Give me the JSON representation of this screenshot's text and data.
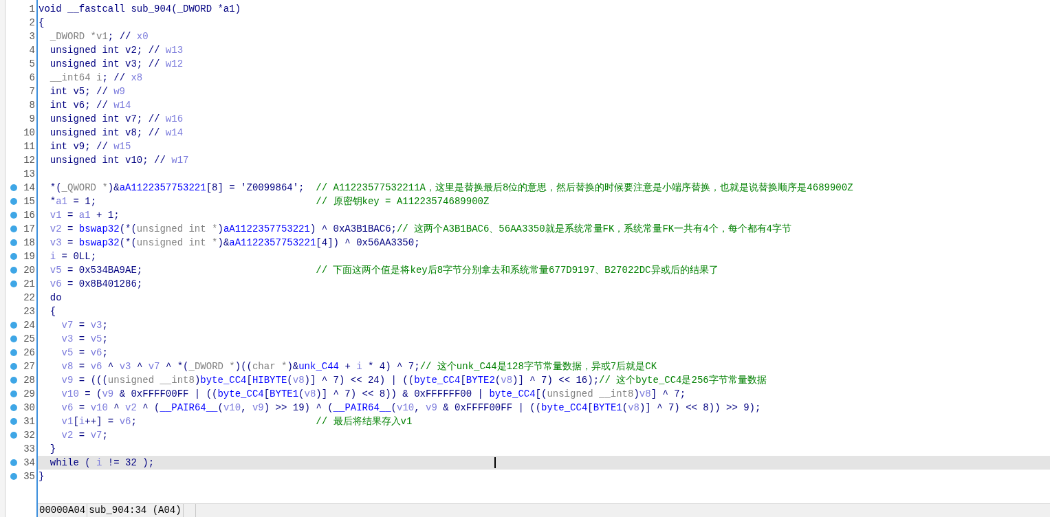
{
  "lines": [
    {
      "number": "1",
      "breakpoint": false,
      "current": false,
      "segments": [
        {
          "kind": "plain",
          "text": "void __fastcall sub_904(_DWORD *a1)"
        }
      ]
    },
    {
      "number": "2",
      "breakpoint": false,
      "current": false,
      "segments": [
        {
          "kind": "plain",
          "text": "{"
        }
      ]
    },
    {
      "number": "3",
      "breakpoint": false,
      "current": false,
      "segments": [
        {
          "kind": "type",
          "text": "  _DWORD *v1"
        },
        {
          "kind": "plain",
          "text": "; // "
        },
        {
          "kind": "local",
          "text": "x0"
        }
      ]
    },
    {
      "number": "4",
      "breakpoint": false,
      "current": false,
      "segments": [
        {
          "kind": "plain",
          "text": "  unsigned int v2; // "
        },
        {
          "kind": "local",
          "text": "w13"
        }
      ]
    },
    {
      "number": "5",
      "breakpoint": false,
      "current": false,
      "segments": [
        {
          "kind": "plain",
          "text": "  unsigned int v3; // "
        },
        {
          "kind": "local",
          "text": "w12"
        }
      ]
    },
    {
      "number": "6",
      "breakpoint": false,
      "current": false,
      "segments": [
        {
          "kind": "type",
          "text": "  __int64 i"
        },
        {
          "kind": "plain",
          "text": "; // "
        },
        {
          "kind": "local",
          "text": "x8"
        }
      ]
    },
    {
      "number": "7",
      "breakpoint": false,
      "current": false,
      "segments": [
        {
          "kind": "plain",
          "text": "  int v5; // "
        },
        {
          "kind": "local",
          "text": "w9"
        }
      ]
    },
    {
      "number": "8",
      "breakpoint": false,
      "current": false,
      "segments": [
        {
          "kind": "plain",
          "text": "  int v6; // "
        },
        {
          "kind": "local",
          "text": "w14"
        }
      ]
    },
    {
      "number": "9",
      "breakpoint": false,
      "current": false,
      "segments": [
        {
          "kind": "plain",
          "text": "  unsigned int v7; // "
        },
        {
          "kind": "local",
          "text": "w16"
        }
      ]
    },
    {
      "number": "10",
      "breakpoint": false,
      "current": false,
      "segments": [
        {
          "kind": "plain",
          "text": "  unsigned int v8; // "
        },
        {
          "kind": "local",
          "text": "w14"
        }
      ]
    },
    {
      "number": "11",
      "breakpoint": false,
      "current": false,
      "segments": [
        {
          "kind": "plain",
          "text": "  int v9; // "
        },
        {
          "kind": "local",
          "text": "w15"
        }
      ]
    },
    {
      "number": "12",
      "breakpoint": false,
      "current": false,
      "segments": [
        {
          "kind": "plain",
          "text": "  unsigned int v10; // "
        },
        {
          "kind": "local",
          "text": "w17"
        }
      ]
    },
    {
      "number": "13",
      "breakpoint": false,
      "current": false
    },
    {
      "number": "14",
      "breakpoint": true,
      "current": false,
      "segments": [
        {
          "kind": "plain",
          "text": "  *("
        },
        {
          "kind": "type",
          "text": "_QWORD *"
        },
        {
          "kind": "plain",
          "text": ")&"
        },
        {
          "kind": "global",
          "text": "aA1122357753221"
        },
        {
          "kind": "plain",
          "text": "[8] = 'Z0099864';  "
        },
        {
          "kind": "comment",
          "text": "// A11223577532211A，这里是替换最后8位的意思，然后替换的时候要注意是小端序替换，也就是说替换顺序是4689900Z"
        }
      ]
    },
    {
      "number": "15",
      "breakpoint": true,
      "current": false,
      "segments": [
        {
          "kind": "plain",
          "text": "  *"
        },
        {
          "kind": "local",
          "text": "a1"
        },
        {
          "kind": "plain",
          "text": " = 1;                                      "
        },
        {
          "kind": "comment",
          "text": "// 原密钥key = A11223574689900Z"
        }
      ]
    },
    {
      "number": "16",
      "breakpoint": true,
      "current": false,
      "segments": [
        {
          "kind": "local",
          "text": "  v1"
        },
        {
          "kind": "plain",
          "text": " = "
        },
        {
          "kind": "local",
          "text": "a1"
        },
        {
          "kind": "plain",
          "text": " + 1;"
        }
      ]
    },
    {
      "number": "17",
      "breakpoint": true,
      "current": false,
      "segments": [
        {
          "kind": "local",
          "text": "  v2"
        },
        {
          "kind": "plain",
          "text": " = "
        },
        {
          "kind": "global",
          "text": "bswap32"
        },
        {
          "kind": "plain",
          "text": "(*("
        },
        {
          "kind": "type",
          "text": "unsigned int *"
        },
        {
          "kind": "plain",
          "text": ")"
        },
        {
          "kind": "global",
          "text": "aA1122357753221"
        },
        {
          "kind": "plain",
          "text": ") ^ 0xA3B1BAC6;"
        },
        {
          "kind": "comment",
          "text": "// 这两个A3B1BAC6、56AA3350就是系统常量FK，系统常量FK一共有4个，每个都有4字节"
        }
      ]
    },
    {
      "number": "18",
      "breakpoint": true,
      "current": false,
      "segments": [
        {
          "kind": "local",
          "text": "  v3"
        },
        {
          "kind": "plain",
          "text": " = "
        },
        {
          "kind": "global",
          "text": "bswap32"
        },
        {
          "kind": "plain",
          "text": "(*("
        },
        {
          "kind": "type",
          "text": "unsigned int *"
        },
        {
          "kind": "plain",
          "text": ")&"
        },
        {
          "kind": "global",
          "text": "aA1122357753221"
        },
        {
          "kind": "plain",
          "text": "[4]) ^ 0x56AA3350;"
        }
      ]
    },
    {
      "number": "19",
      "breakpoint": true,
      "current": false,
      "segments": [
        {
          "kind": "local",
          "text": "  i"
        },
        {
          "kind": "plain",
          "text": " = 0LL;"
        }
      ]
    },
    {
      "number": "20",
      "breakpoint": true,
      "current": false,
      "segments": [
        {
          "kind": "local",
          "text": "  v5"
        },
        {
          "kind": "plain",
          "text": " = 0x534BA9AE;                              "
        },
        {
          "kind": "comment",
          "text": "// 下面这两个值是将key后8字节分别拿去和系统常量677D9197、B27022DC异或后的结果了"
        }
      ]
    },
    {
      "number": "21",
      "breakpoint": true,
      "current": false,
      "segments": [
        {
          "kind": "local",
          "text": "  v6"
        },
        {
          "kind": "plain",
          "text": " = 0x8B401286;"
        }
      ]
    },
    {
      "number": "22",
      "breakpoint": false,
      "current": false,
      "segments": [
        {
          "kind": "plain",
          "text": "  do"
        }
      ]
    },
    {
      "number": "23",
      "breakpoint": false,
      "current": false,
      "segments": [
        {
          "kind": "plain",
          "text": "  {"
        }
      ]
    },
    {
      "number": "24",
      "breakpoint": true,
      "current": false,
      "segments": [
        {
          "kind": "local",
          "text": "    v7"
        },
        {
          "kind": "plain",
          "text": " = "
        },
        {
          "kind": "local",
          "text": "v3"
        },
        {
          "kind": "plain",
          "text": ";"
        }
      ]
    },
    {
      "number": "25",
      "breakpoint": true,
      "current": false,
      "segments": [
        {
          "kind": "local",
          "text": "    v3"
        },
        {
          "kind": "plain",
          "text": " = "
        },
        {
          "kind": "local",
          "text": "v5"
        },
        {
          "kind": "plain",
          "text": ";"
        }
      ]
    },
    {
      "number": "26",
      "breakpoint": true,
      "current": false,
      "segments": [
        {
          "kind": "local",
          "text": "    v5"
        },
        {
          "kind": "plain",
          "text": " = "
        },
        {
          "kind": "local",
          "text": "v6"
        },
        {
          "kind": "plain",
          "text": ";"
        }
      ]
    },
    {
      "number": "27",
      "breakpoint": true,
      "current": false,
      "segments": [
        {
          "kind": "local",
          "text": "    v8"
        },
        {
          "kind": "plain",
          "text": " = "
        },
        {
          "kind": "local",
          "text": "v6"
        },
        {
          "kind": "plain",
          "text": " ^ "
        },
        {
          "kind": "local",
          "text": "v3"
        },
        {
          "kind": "plain",
          "text": " ^ "
        },
        {
          "kind": "local",
          "text": "v7"
        },
        {
          "kind": "plain",
          "text": " ^ *("
        },
        {
          "kind": "type",
          "text": "_DWORD *"
        },
        {
          "kind": "plain",
          "text": ")(("
        },
        {
          "kind": "type",
          "text": "char *"
        },
        {
          "kind": "plain",
          "text": ")&"
        },
        {
          "kind": "global",
          "text": "unk_C44"
        },
        {
          "kind": "plain",
          "text": " + "
        },
        {
          "kind": "local",
          "text": "i"
        },
        {
          "kind": "plain",
          "text": " * 4) ^ 7;"
        },
        {
          "kind": "comment",
          "text": "// 这个unk_C44是128字节常量数据，异或7后就是CK"
        }
      ]
    },
    {
      "number": "28",
      "breakpoint": true,
      "current": false,
      "segments": [
        {
          "kind": "local",
          "text": "    v9"
        },
        {
          "kind": "plain",
          "text": " = ((("
        },
        {
          "kind": "type",
          "text": "unsigned __int8"
        },
        {
          "kind": "plain",
          "text": ")"
        },
        {
          "kind": "global",
          "text": "byte_CC4"
        },
        {
          "kind": "plain",
          "text": "["
        },
        {
          "kind": "global",
          "text": "HIBYTE"
        },
        {
          "kind": "plain",
          "text": "("
        },
        {
          "kind": "local",
          "text": "v8"
        },
        {
          "kind": "plain",
          "text": ")] ^ 7) << 24) | (("
        },
        {
          "kind": "global",
          "text": "byte_CC4"
        },
        {
          "kind": "plain",
          "text": "["
        },
        {
          "kind": "global",
          "text": "BYTE2"
        },
        {
          "kind": "plain",
          "text": "("
        },
        {
          "kind": "local",
          "text": "v8"
        },
        {
          "kind": "plain",
          "text": ")] ^ 7) << 16);"
        },
        {
          "kind": "comment",
          "text": "// 这个byte_CC4是256字节常量数据"
        }
      ]
    },
    {
      "number": "29",
      "breakpoint": true,
      "current": false,
      "segments": [
        {
          "kind": "local",
          "text": "    v10"
        },
        {
          "kind": "plain",
          "text": " = ("
        },
        {
          "kind": "local",
          "text": "v9"
        },
        {
          "kind": "plain",
          "text": " & 0xFFFF00FF | (("
        },
        {
          "kind": "global",
          "text": "byte_CC4"
        },
        {
          "kind": "plain",
          "text": "["
        },
        {
          "kind": "global",
          "text": "BYTE1"
        },
        {
          "kind": "plain",
          "text": "("
        },
        {
          "kind": "local",
          "text": "v8"
        },
        {
          "kind": "plain",
          "text": ")] ^ 7) << 8)) & 0xFFFFFF00 | "
        },
        {
          "kind": "global",
          "text": "byte_CC4"
        },
        {
          "kind": "plain",
          "text": "[("
        },
        {
          "kind": "type",
          "text": "unsigned __int8"
        },
        {
          "kind": "plain",
          "text": ")"
        },
        {
          "kind": "local",
          "text": "v8"
        },
        {
          "kind": "plain",
          "text": "] ^ 7;"
        }
      ]
    },
    {
      "number": "30",
      "breakpoint": true,
      "current": false,
      "segments": [
        {
          "kind": "local",
          "text": "    v6"
        },
        {
          "kind": "plain",
          "text": " = "
        },
        {
          "kind": "local",
          "text": "v10"
        },
        {
          "kind": "plain",
          "text": " ^ "
        },
        {
          "kind": "local",
          "text": "v2"
        },
        {
          "kind": "plain",
          "text": " ^ ("
        },
        {
          "kind": "global",
          "text": "__PAIR64__"
        },
        {
          "kind": "plain",
          "text": "("
        },
        {
          "kind": "local",
          "text": "v10"
        },
        {
          "kind": "plain",
          "text": ", "
        },
        {
          "kind": "local",
          "text": "v9"
        },
        {
          "kind": "plain",
          "text": ") >> 19) ^ ("
        },
        {
          "kind": "global",
          "text": "__PAIR64__"
        },
        {
          "kind": "plain",
          "text": "("
        },
        {
          "kind": "local",
          "text": "v10"
        },
        {
          "kind": "plain",
          "text": ", "
        },
        {
          "kind": "local",
          "text": "v9"
        },
        {
          "kind": "plain",
          "text": " & 0xFFFF00FF | (("
        },
        {
          "kind": "global",
          "text": "byte_CC4"
        },
        {
          "kind": "plain",
          "text": "["
        },
        {
          "kind": "global",
          "text": "BYTE1"
        },
        {
          "kind": "plain",
          "text": "("
        },
        {
          "kind": "local",
          "text": "v8"
        },
        {
          "kind": "plain",
          "text": ")] ^ 7) << 8)) >> 9);"
        }
      ]
    },
    {
      "number": "31",
      "breakpoint": true,
      "current": false,
      "segments": [
        {
          "kind": "local",
          "text": "    v1"
        },
        {
          "kind": "plain",
          "text": "["
        },
        {
          "kind": "local",
          "text": "i"
        },
        {
          "kind": "plain",
          "text": "++] = "
        },
        {
          "kind": "local",
          "text": "v6"
        },
        {
          "kind": "plain",
          "text": ";                               "
        },
        {
          "kind": "comment",
          "text": "// 最后将结果存入v1"
        }
      ]
    },
    {
      "number": "32",
      "breakpoint": true,
      "current": false,
      "segments": [
        {
          "kind": "local",
          "text": "    v2"
        },
        {
          "kind": "plain",
          "text": " = "
        },
        {
          "kind": "local",
          "text": "v7"
        },
        {
          "kind": "plain",
          "text": ";"
        }
      ]
    },
    {
      "number": "33",
      "breakpoint": false,
      "current": false,
      "segments": [
        {
          "kind": "plain",
          "text": "  }"
        }
      ]
    },
    {
      "number": "34",
      "breakpoint": true,
      "current": true,
      "segments": [
        {
          "kind": "plain",
          "text": "  while ( "
        },
        {
          "kind": "local",
          "text": "i"
        },
        {
          "kind": "plain",
          "text": " != 32 );"
        }
      ]
    },
    {
      "number": "35",
      "breakpoint": true,
      "current": false,
      "segments": [
        {
          "kind": "plain",
          "text": "}"
        }
      ]
    }
  ],
  "status_bar": {
    "address": "00000A04",
    "location": "sub_904:34 (A04)"
  }
}
